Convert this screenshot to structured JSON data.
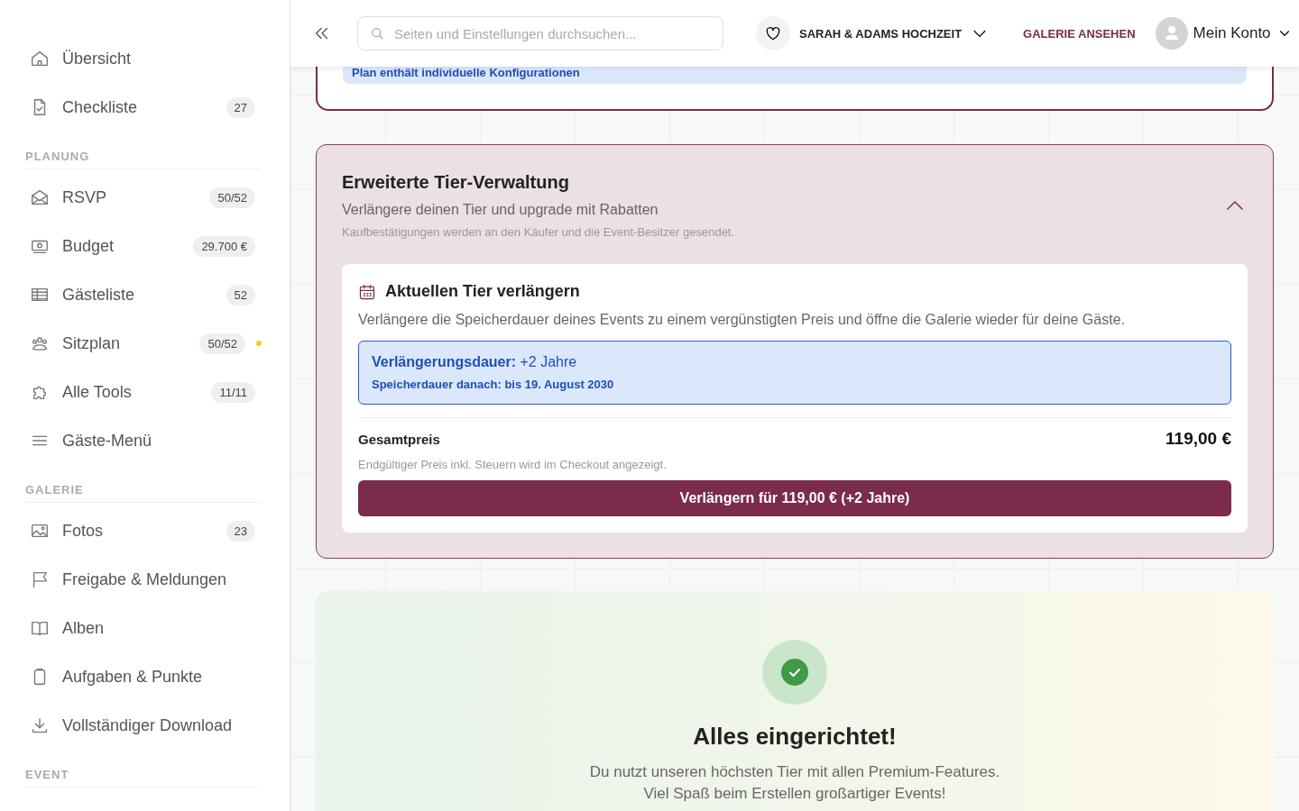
{
  "sidebar": {
    "sections": [
      {
        "items": [
          {
            "label": "Übersicht"
          },
          {
            "label": "Checkliste",
            "badge": "27"
          }
        ]
      },
      {
        "heading": "PLANUNG",
        "items": [
          {
            "label": "RSVP",
            "badge": "50/52"
          },
          {
            "label": "Budget",
            "badge": "29.700 €"
          },
          {
            "label": "Gästeliste",
            "badge": "52"
          },
          {
            "label": "Sitzplan",
            "badge": "50/52",
            "color": "#facc15"
          },
          {
            "label": "Alle Tools",
            "badge": "11/11"
          },
          {
            "label": "Gäste-Menü"
          }
        ]
      },
      {
        "heading": "GALERIE",
        "items": [
          {
            "label": "Fotos",
            "badge": "23"
          },
          {
            "label": "Freigabe & Meldungen"
          },
          {
            "label": "Alben"
          },
          {
            "label": "Aufgaben & Punkte"
          },
          {
            "label": "Vollständiger Download"
          }
        ]
      },
      {
        "heading": "EVENT"
      }
    ]
  },
  "header": {
    "search": {
      "placeholder": "Seiten und Einstellungen durchsuchen..."
    },
    "event": "SARAH & ADAMS HOCHZEIT",
    "gallery_link": "GALERIE ANSEHEN",
    "account": "Mein Konto"
  },
  "plan_card": {
    "note": "Plan enthält individuelle Konfigurationen"
  },
  "tier_card": {
    "title": "Erweiterte Tier-Verwaltung",
    "subtitle": "Verlängere deinen Tier und upgrade mit Rabatten",
    "hint": "Kaufbestätigungen werden an den Käufer und die Event-Besitzer gesendet.",
    "expanded": true,
    "extend": {
      "title": "Aktuellen Tier verlängern",
      "description": "Verlängere die Speicherdauer deines Events zu einem vergünstigten Preis und öffne die Galerie wieder für deine Gäste.",
      "duration_label": "Verlängerungsdauer:",
      "duration": "+2 Jahre",
      "until": "Speicherdauer danach: bis 19. August 2030",
      "total_label": "Gesamtpreis",
      "total": "119,00 €",
      "tax_note": "Endgültiger Preis inkl. Steuern wird im Checkout angezeigt.",
      "button": "Verlängern für 119,00 € (+2 Jahre)"
    }
  },
  "success": {
    "title": "Alles eingerichtet!",
    "lines": [
      "Du nutzt unseren höchsten Tier mit allen Premium-Features.",
      "Viel Spaß beim Erstellen großartiger Events!"
    ]
  }
}
